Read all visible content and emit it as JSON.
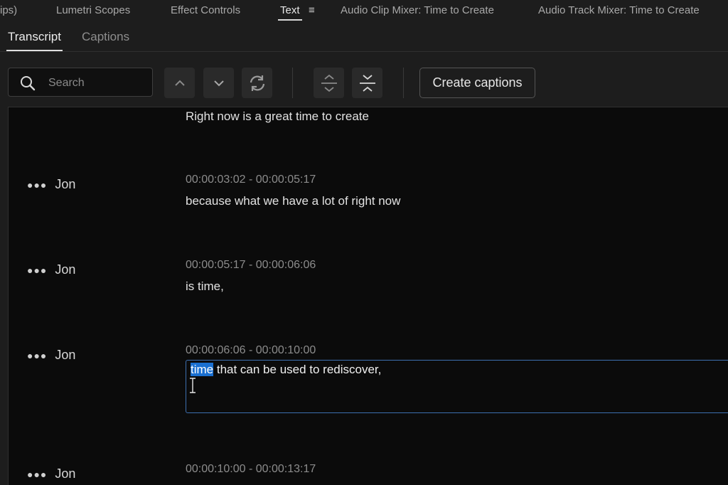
{
  "panel_tabs": {
    "clipped": "ips)",
    "lumetri": "Lumetri Scopes",
    "effect_controls": "Effect Controls",
    "text": "Text",
    "text_menu": "≡",
    "audio_clip_mixer": "Audio Clip Mixer: Time to Create",
    "audio_track_mixer": "Audio Track Mixer: Time to Create"
  },
  "sub_tabs": {
    "transcript": "Transcript",
    "captions": "Captions"
  },
  "toolbar": {
    "search_placeholder": "Search",
    "search_value": "",
    "create_captions": "Create captions"
  },
  "colors": {
    "selection": "#1a6fd0",
    "edit_border": "#3d6fb0",
    "panel_bg": "#0b0b0b"
  },
  "transcript": {
    "top_line": "Right now is a great time to create",
    "segments": [
      {
        "speaker": "Jon",
        "timecode": "00:00:03:02 - 00:00:05:17",
        "text": "because what we have a lot of right now"
      },
      {
        "speaker": "Jon",
        "timecode": "00:00:05:17 - 00:00:06:06",
        "text": "is time,"
      },
      {
        "speaker": "Jon",
        "timecode": "00:00:06:06 - 00:00:10:00",
        "selected_word": "time",
        "text_rest": " that can be used to rediscover,"
      },
      {
        "speaker": "Jon",
        "timecode": "00:00:10:00 - 00:00:13:17"
      }
    ]
  }
}
